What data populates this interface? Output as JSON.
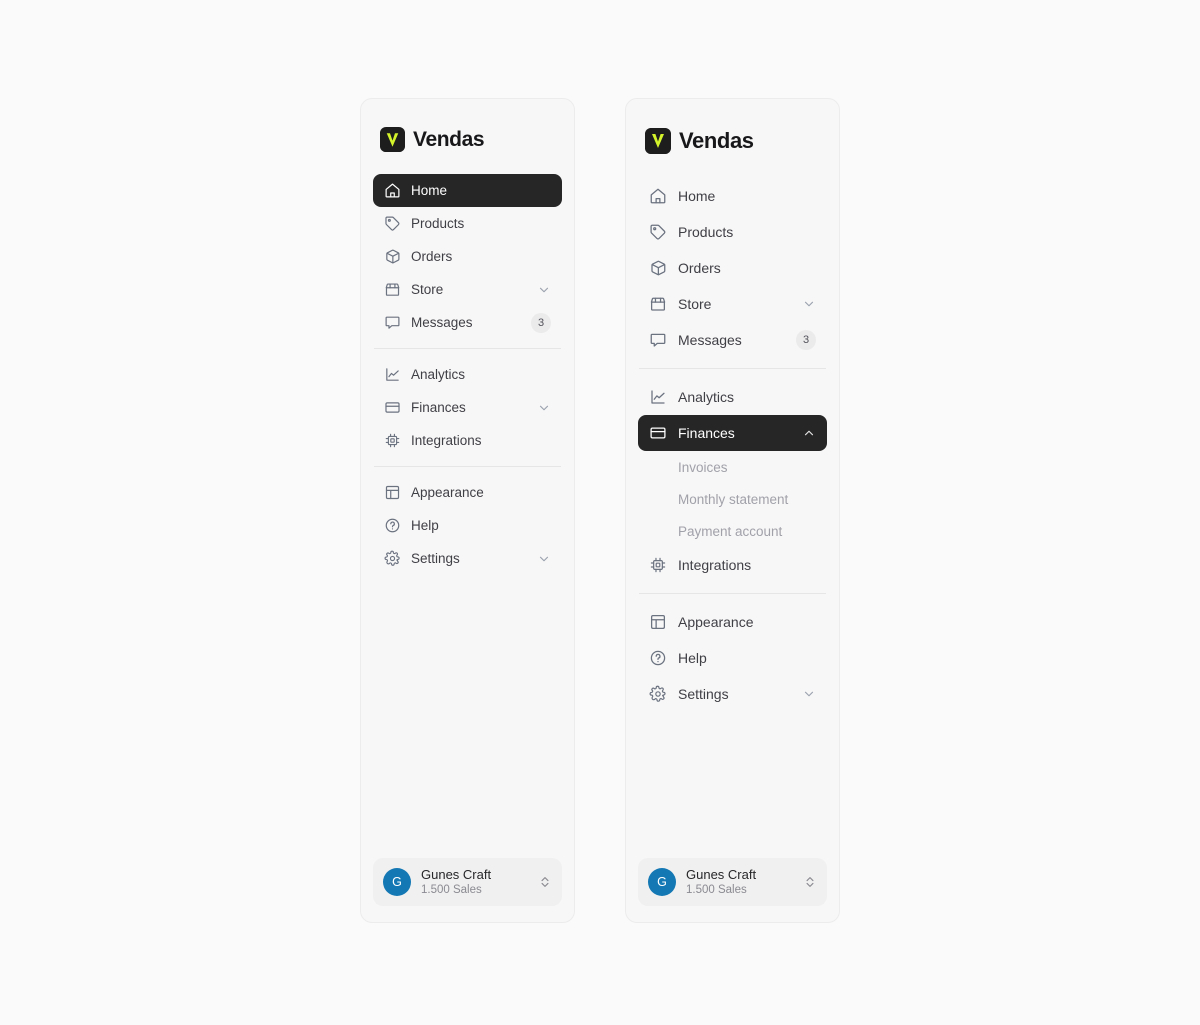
{
  "brand": {
    "name": "Vendas",
    "logo_icon": "vendas-v-logo",
    "logo_bg": "#1d1d1d",
    "logo_accent": "#d4f32a"
  },
  "colors": {
    "page_bg": "#fafafa",
    "panel_bg": "#f7f7f7",
    "panel_border": "#ececec",
    "active_bg": "#262626",
    "active_text": "#ffffff",
    "item_text": "#3f3f46",
    "icon": "#6b7280",
    "subitem_text": "#a1a1aa",
    "badge_bg": "#ebebeb",
    "avatar_bg": "#1478b4"
  },
  "sidebar_collapsed": {
    "groups": [
      {
        "items": [
          {
            "label": "Home",
            "icon": "home-icon",
            "active": true
          },
          {
            "label": "Products",
            "icon": "tag-icon",
            "active": false
          },
          {
            "label": "Orders",
            "icon": "package-icon",
            "active": false
          },
          {
            "label": "Store",
            "icon": "storefront-icon",
            "active": false,
            "chevron": "chevron-down-icon"
          },
          {
            "label": "Messages",
            "icon": "message-icon",
            "active": false,
            "badge": "3"
          }
        ]
      },
      {
        "items": [
          {
            "label": "Analytics",
            "icon": "chart-line-icon",
            "active": false
          },
          {
            "label": "Finances",
            "icon": "credit-card-icon",
            "active": false,
            "chevron": "chevron-down-icon"
          },
          {
            "label": "Integrations",
            "icon": "chip-icon",
            "active": false
          }
        ]
      },
      {
        "items": [
          {
            "label": "Appearance",
            "icon": "layout-icon",
            "active": false
          },
          {
            "label": "Help",
            "icon": "help-circle-icon",
            "active": false
          },
          {
            "label": "Settings",
            "icon": "gear-icon",
            "active": false,
            "chevron": "chevron-down-icon"
          }
        ]
      }
    ],
    "profile": {
      "avatar_initial": "G",
      "name": "Gunes Craft",
      "subtitle": "1.500 Sales",
      "selector_icon": "chevron-up-down-icon"
    }
  },
  "sidebar_expanded": {
    "groups": [
      {
        "items": [
          {
            "label": "Home",
            "icon": "home-icon",
            "active": false
          },
          {
            "label": "Products",
            "icon": "tag-icon",
            "active": false
          },
          {
            "label": "Orders",
            "icon": "package-icon",
            "active": false
          },
          {
            "label": "Store",
            "icon": "storefront-icon",
            "active": false,
            "chevron": "chevron-down-icon"
          },
          {
            "label": "Messages",
            "icon": "message-icon",
            "active": false,
            "badge": "3"
          }
        ]
      },
      {
        "items": [
          {
            "label": "Analytics",
            "icon": "chart-line-icon",
            "active": false
          },
          {
            "label": "Finances",
            "icon": "credit-card-icon",
            "active": true,
            "chevron": "chevron-up-icon",
            "children": [
              {
                "label": "Invoices"
              },
              {
                "label": "Monthly statement"
              },
              {
                "label": "Payment account"
              }
            ]
          },
          {
            "label": "Integrations",
            "icon": "chip-icon",
            "active": false
          }
        ]
      },
      {
        "items": [
          {
            "label": "Appearance",
            "icon": "layout-icon",
            "active": false
          },
          {
            "label": "Help",
            "icon": "help-circle-icon",
            "active": false
          },
          {
            "label": "Settings",
            "icon": "gear-icon",
            "active": false,
            "chevron": "chevron-down-icon"
          }
        ]
      }
    ],
    "profile": {
      "avatar_initial": "G",
      "name": "Gunes Craft",
      "subtitle": "1.500 Sales",
      "selector_icon": "chevron-up-down-icon"
    }
  }
}
